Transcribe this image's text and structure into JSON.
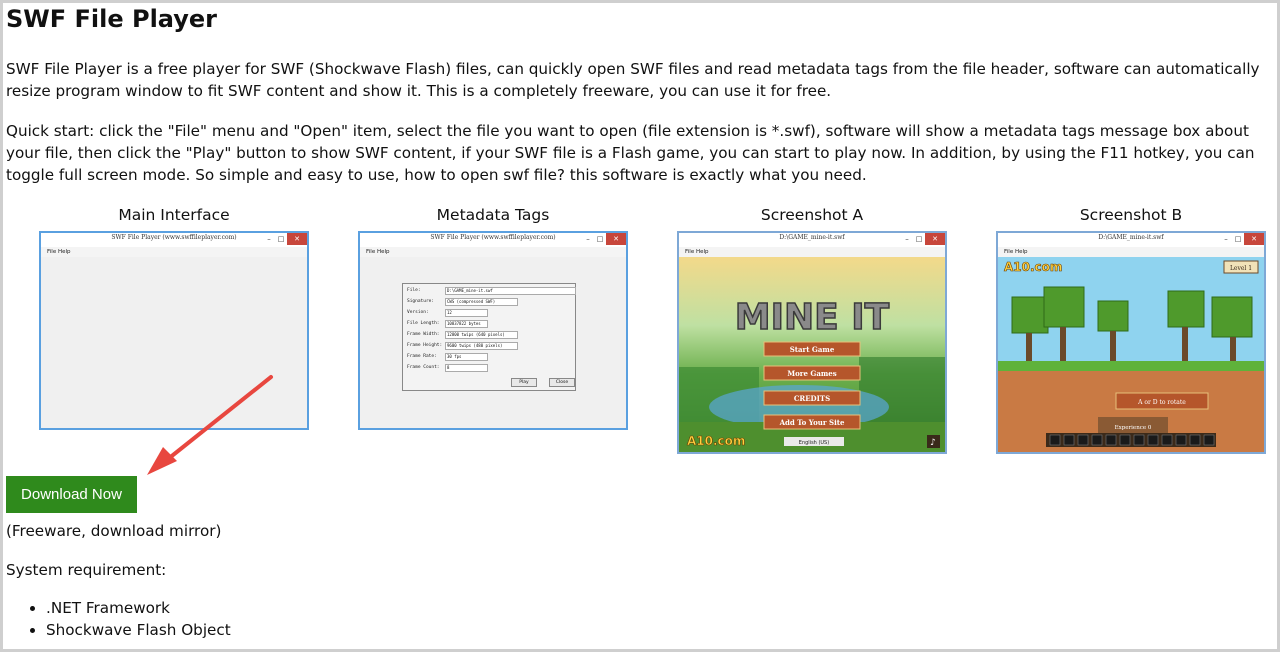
{
  "title": "SWF File Player",
  "intro": "SWF File Player is a free player for SWF (Shockwave Flash) files, can quickly open SWF files and read metadata tags from the file header, software can automatically resize program window to fit SWF content and show it. This is a completely freeware, you can use it for free.",
  "quickstart": "Quick start: click the \"File\" menu and \"Open\" item, select the file you want to open (file extension is *.swf), software will show a metadata tags message box about your file, then click the \"Play\" button to show SWF content, if your SWF file is a Flash game, you can start to play now. In addition, by using the F11 hotkey, you can toggle full screen mode. So simple and easy to use, how to open swf file? this software is exactly what you need.",
  "screenshots": [
    {
      "caption": "Main Interface",
      "window_title": "SWF File Player (www.swffileplayer.com)",
      "menu": "File   Help"
    },
    {
      "caption": "Metadata Tags",
      "window_title": "SWF File Player (www.swffileplayer.com)",
      "menu": "File   Help",
      "dialog": {
        "rows": [
          {
            "label": "File:",
            "value": "D:\\GAME_mine-it.swf"
          },
          {
            "label": "Signature:",
            "value": "CWS (compressed SWF)"
          },
          {
            "label": "Version:",
            "value": "12"
          },
          {
            "label": "File Length:",
            "value": "10837822 bytes"
          },
          {
            "label": "Frame Width:",
            "value": "12800 twips (640 pixels)"
          },
          {
            "label": "Frame Height:",
            "value": "9600 twips (480 pixels)"
          },
          {
            "label": "Frame Rate:",
            "value": "30 fps"
          },
          {
            "label": "Frame Count:",
            "value": "8"
          }
        ],
        "play_label": "Play",
        "close_label": "Close"
      }
    },
    {
      "caption": "Screenshot A",
      "window_title": "D:\\GAME_mine-it.swf",
      "menu": "File   Help",
      "game": {
        "logo": "MINE IT",
        "buttons": [
          "Start Game",
          "More Games",
          "CREDITS",
          "Add To Your Site"
        ],
        "brand": "A10.com",
        "lang": "English (US)"
      }
    },
    {
      "caption": "Screenshot B",
      "window_title": "D:\\GAME_mine-it.swf",
      "menu": "File   Help",
      "game": {
        "brand": "A10.com",
        "level": "Level 1",
        "hint": "A or D to rotate",
        "exp": "Experience 0"
      }
    }
  ],
  "download_label": "Download Now",
  "download_note": "(Freeware, download mirror)",
  "requirements_label": "System requirement:",
  "requirements": [
    ".NET Framework",
    "Shockwave Flash Object"
  ],
  "colors": {
    "download_button": "#2f8a1c",
    "window_border": "#5aa0e0",
    "arrow": "#e8473f"
  }
}
